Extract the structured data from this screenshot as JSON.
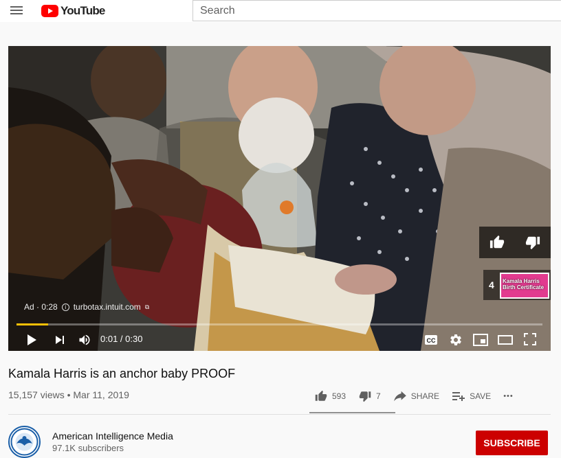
{
  "header": {
    "logo_text": "YouTube",
    "search_placeholder": "Search"
  },
  "player": {
    "ad_label": "Ad · 0:28",
    "ad_domain": "turbotax.intuit.com",
    "time_display": "0:01 / 0:30",
    "progress_fraction": 0.06,
    "up_next_number": "4",
    "up_next_thumb_text": "Kamala Harris Birth Certificate"
  },
  "video": {
    "title": "Kamala Harris is an anchor baby PROOF",
    "views_date": "15,157 views • Mar 11, 2019",
    "likes": "593",
    "dislikes": "7",
    "share_label": "SHARE",
    "save_label": "SAVE",
    "more_label": "•••"
  },
  "channel": {
    "name": "American Intelligence Media",
    "subscribers": "97.1K subscribers",
    "subscribe_label": "SUBSCRIBE"
  },
  "colors": {
    "brand_red": "#ff0000",
    "subscribe_red": "#cc0000",
    "ad_progress": "#ffc107"
  },
  "icons": [
    "menu-icon",
    "play-icon",
    "next-icon",
    "volume-icon",
    "cc-icon",
    "gear-icon",
    "miniplayer-icon",
    "theater-icon",
    "fullscreen-icon",
    "thumbs-up-icon",
    "thumbs-down-icon",
    "share-icon",
    "playlist-add-icon",
    "info-icon",
    "external-link-icon"
  ]
}
